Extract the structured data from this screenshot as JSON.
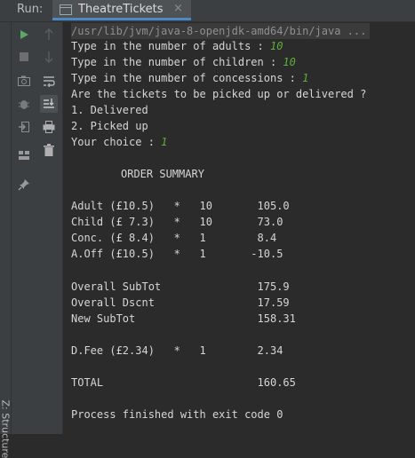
{
  "header": {
    "run_label": "Run:",
    "tab_title": "TheatreTickets",
    "tab_close": "×"
  },
  "sidebar": {
    "structure_label": "Z: Structure"
  },
  "toolbar": {
    "icons": [
      "run-icon",
      "stop-icon",
      "camera-icon",
      "debug-icon",
      "exit-icon",
      "layout-icon",
      "pin-icon",
      "up-arrow-icon",
      "down-arrow-icon",
      "soft-wrap-icon",
      "scroll-to-end-icon",
      "print-icon",
      "trash-icon"
    ]
  },
  "colors": {
    "run_green": "#59a869",
    "input_green": "#5fae3a",
    "tab_underline": "#4a88c7"
  },
  "console": {
    "command": "/usr/lib/jvm/java-8-openjdk-amd64/bin/java ...",
    "prompts": [
      {
        "text": "Type in the number of adults : ",
        "input": "10"
      },
      {
        "text": "Type in the number of children : ",
        "input": "10"
      },
      {
        "text": "Type in the number of concessions : ",
        "input": "1"
      }
    ],
    "question": "Are the tickets to be picked up or delivered ?",
    "option1": "1. Delivered",
    "option2": "2. Picked up",
    "choice_prompt": "Your choice : ",
    "choice_input": "1",
    "summary_title": "ORDER SUMMARY",
    "rows": [
      "Adult (£10.5)   *   10       105.0",
      "Child (£ 7.3)   *   10       73.0",
      "Conc. (£ 8.4)   *   1        8.4",
      "A.Off (£10.5)   *   1       -10.5"
    ],
    "subtotals": [
      "Overall SubTot               175.9",
      "Overall Dscnt                17.59",
      "New SubTot                   158.31"
    ],
    "delivery": "D.Fee (£2.34)   *   1        2.34",
    "total": "TOTAL                        160.65",
    "exit_message": "Process finished with exit code 0"
  }
}
